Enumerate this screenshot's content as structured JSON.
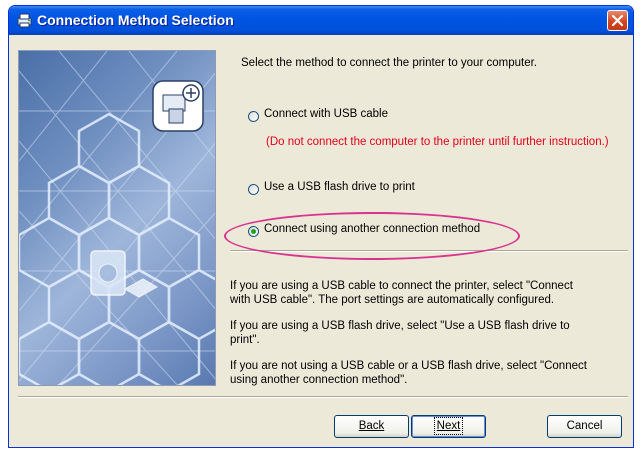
{
  "window": {
    "title": "Connection Method Selection"
  },
  "main": {
    "instruction": "Select the method to connect the printer to your computer.",
    "options": [
      {
        "label": "Connect with USB cable",
        "checked": false
      },
      {
        "label": "Use a USB flash drive to print",
        "checked": false
      },
      {
        "label": "Connect using another connection method",
        "checked": true
      }
    ],
    "usb_warning": "(Do not connect the computer to the printer until further instruction.)",
    "help": [
      "If you are using a USB cable to connect the printer, select \"Connect",
      "with USB cable\". The port settings are automatically configured.",
      "If you are using a USB flash drive, select \"Use a USB flash drive to",
      "print\".",
      "If you are not using a USB cable or a USB flash drive, select \"Connect",
      "using another connection method\"."
    ]
  },
  "buttons": {
    "back": "Back",
    "next": "Next",
    "cancel": "Cancel"
  },
  "colors": {
    "titlebar": "#0054e3",
    "warning": "#e2001a",
    "highlight": "#d8338f",
    "radio_selected": "#21a121"
  },
  "icons": {
    "title": "printer-icon",
    "close": "close-icon",
    "banner": "printer-connection-icon"
  }
}
